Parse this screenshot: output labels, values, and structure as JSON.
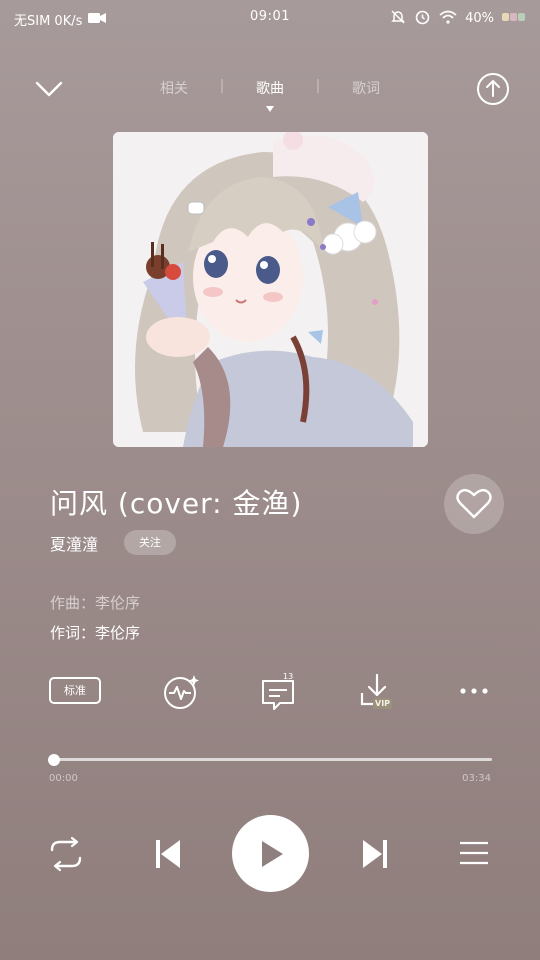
{
  "status_bar": {
    "carrier": "无SIM 0K/s",
    "time": "09:01",
    "battery": "40%"
  },
  "tabs": [
    {
      "label": "相关",
      "active": false
    },
    {
      "label": "歌曲",
      "active": true
    },
    {
      "label": "歌词",
      "active": false
    }
  ],
  "song": {
    "title": "问风 (cover: 金渔)",
    "artist": "夏潼潼",
    "follow_label": "关注",
    "composer": "作曲：李伦序",
    "lyricist": "作词：李伦序"
  },
  "actions": {
    "quality_label": "标准",
    "comment_count": "13",
    "vip_label": "VIP"
  },
  "progress": {
    "current": "00:00",
    "total": "03:34",
    "fraction": 0.0
  },
  "colors": {
    "background": "#a09291",
    "accent": "#ffffff"
  }
}
